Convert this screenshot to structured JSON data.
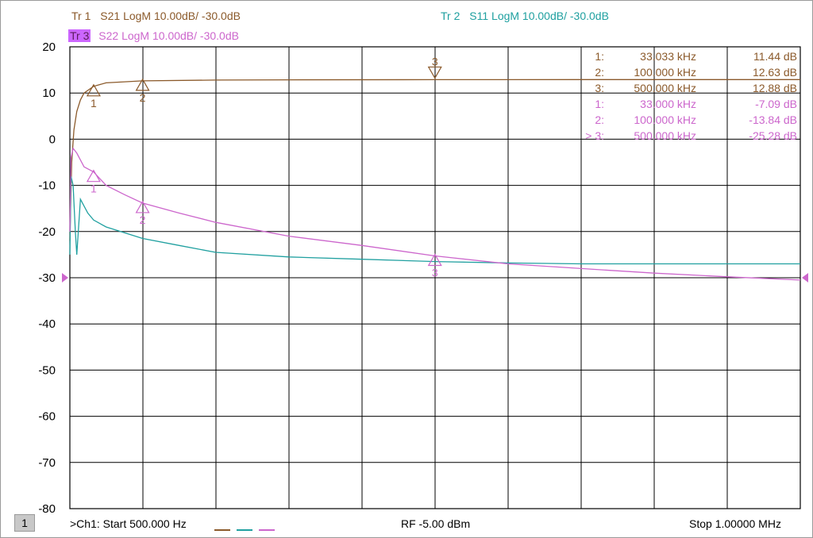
{
  "headers": {
    "tr1": {
      "prefix": "Tr  1",
      "text": "S21 LogM 10.00dB/  -30.0dB",
      "color": "#8B5A2B"
    },
    "tr2": {
      "prefix": "Tr  2",
      "text": "S11 LogM 10.00dB/  -30.0dB",
      "color": "#20A0A0"
    },
    "tr3": {
      "prefix": "Tr  3",
      "text": "S22 LogM 10.00dB/  -30.0dB",
      "color": "#CC66CC"
    }
  },
  "footer": {
    "channel": "1",
    "start": ">Ch1:  Start  500.000 Hz",
    "rf": "RF   -5.00 dBm",
    "stop": "Stop  1.00000 MHz"
  },
  "chart_data": {
    "type": "line",
    "y_ticks": [
      "20",
      "10",
      "0",
      "-10",
      "-20",
      "-30",
      "-40",
      "-50",
      "-60",
      "-70",
      "-80"
    ],
    "ylim": [
      -80,
      20
    ],
    "xlim": [
      0.5,
      1000
    ],
    "x_unit": "kHz",
    "x_scale": "linear",
    "reference_level": -30,
    "grid": true,
    "series": [
      {
        "name": "S21",
        "color": "#8B5A2B",
        "x": [
          0.5,
          3,
          6,
          10,
          15,
          20,
          33.033,
          50,
          100,
          200,
          300,
          500,
          700,
          1000
        ],
        "y": [
          -22,
          -5,
          2,
          6,
          8.5,
          10,
          11.44,
          12.2,
          12.63,
          12.8,
          12.85,
          12.88,
          12.9,
          12.9
        ]
      },
      {
        "name": "S11",
        "color": "#20A0A0",
        "x": [
          0.5,
          2,
          5,
          8,
          10,
          15,
          25,
          33,
          50,
          100,
          150,
          200,
          300,
          400,
          500,
          600,
          700,
          800,
          900,
          1000
        ],
        "y": [
          -25,
          -8,
          -10,
          -20,
          -25,
          -13,
          -16,
          -17.5,
          -19,
          -21.5,
          -23,
          -24.5,
          -25.5,
          -26,
          -26.5,
          -26.8,
          -27,
          -27,
          -27,
          -27
        ]
      },
      {
        "name": "S22",
        "color": "#CC66CC",
        "x": [
          0.5,
          2,
          5,
          10,
          20,
          33,
          50,
          75,
          100,
          150,
          200,
          300,
          400,
          500,
          600,
          700,
          800,
          900,
          1000
        ],
        "y": [
          -20,
          -4,
          -2,
          -3,
          -6,
          -7.09,
          -10,
          -12,
          -13.84,
          -16,
          -18,
          -21,
          -23,
          -25.28,
          -27,
          -28,
          -29,
          -29.8,
          -30.5
        ]
      }
    ],
    "markers": [
      {
        "trace": "S21",
        "num": "1",
        "x_label": "33.033",
        "unit": "kHz",
        "value": "11.44 dB",
        "x": 33.033,
        "y": 11.44
      },
      {
        "trace": "S21",
        "num": "2",
        "x_label": "100.000",
        "unit": "kHz",
        "value": "12.63 dB",
        "x": 100,
        "y": 12.63
      },
      {
        "trace": "S21",
        "num": "3",
        "x_label": "500.000",
        "unit": "kHz",
        "value": "12.88 dB",
        "x": 500,
        "y": 12.88
      },
      {
        "trace": "S22",
        "num": "1",
        "x_label": "33.000",
        "unit": "kHz",
        "value": "-7.09 dB",
        "x": 33,
        "y": -7.09
      },
      {
        "trace": "S22",
        "num": "2",
        "x_label": "100.000",
        "unit": "kHz",
        "value": "-13.84 dB",
        "x": 100,
        "y": -13.84
      },
      {
        "trace": "S22",
        "num": "3",
        "x_label": "500.000",
        "unit": "kHz",
        "value": "-25.28 dB",
        "x": 500,
        "y": -25.28,
        "active": true
      }
    ]
  }
}
